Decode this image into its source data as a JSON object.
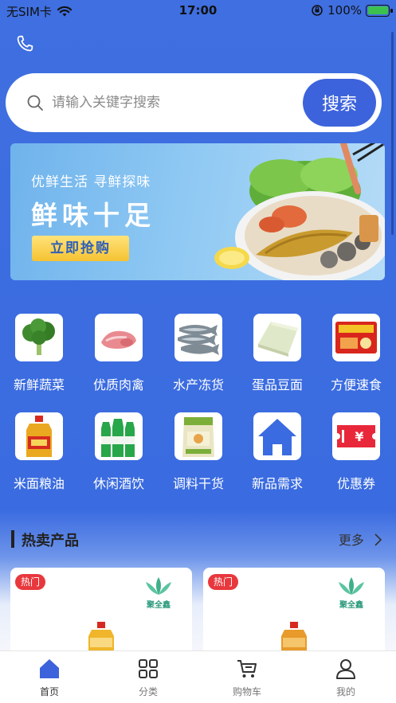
{
  "status_bar": {
    "carrier": "无SIM卡",
    "time": "17:00",
    "battery_pct": "100%"
  },
  "search": {
    "placeholder": "请输入关键字搜索",
    "button_label": "搜索"
  },
  "banner": {
    "slogan": "优鲜生活  寻鲜探味",
    "title": "鲜味十足",
    "cta_label": "立即抢购"
  },
  "categories": [
    {
      "label": "新鲜蔬菜",
      "icon": "broccoli-icon"
    },
    {
      "label": "优质肉禽",
      "icon": "meat-icon"
    },
    {
      "label": "水产冻货",
      "icon": "fish-icon"
    },
    {
      "label": "蛋品豆面",
      "icon": "tofu-icon"
    },
    {
      "label": "方便速食",
      "icon": "instant-noodle-icon"
    },
    {
      "label": "米面粮油",
      "icon": "oil-bottle-icon"
    },
    {
      "label": "休闲酒饮",
      "icon": "drink-bottles-icon"
    },
    {
      "label": "调料干货",
      "icon": "seasoning-bag-icon"
    },
    {
      "label": "新品需求",
      "icon": "home-icon"
    },
    {
      "label": "优惠券",
      "icon": "coupon-icon"
    }
  ],
  "hot_section": {
    "title": "热卖产品",
    "more_label": "更多"
  },
  "products": [
    {
      "tag": "热门",
      "brand": "聚全鑫"
    },
    {
      "tag": "热门",
      "brand": "聚全鑫"
    }
  ],
  "tabs": [
    {
      "label": "首页",
      "icon": "home-tab-icon",
      "active": true
    },
    {
      "label": "分类",
      "icon": "grid-icon",
      "active": false
    },
    {
      "label": "购物车",
      "icon": "cart-icon",
      "active": false
    },
    {
      "label": "我的",
      "icon": "user-icon",
      "active": false
    }
  ],
  "colors": {
    "primary": "#3d63dc",
    "tag_red": "#e8383d",
    "cta_yellow": "#f5c232"
  }
}
